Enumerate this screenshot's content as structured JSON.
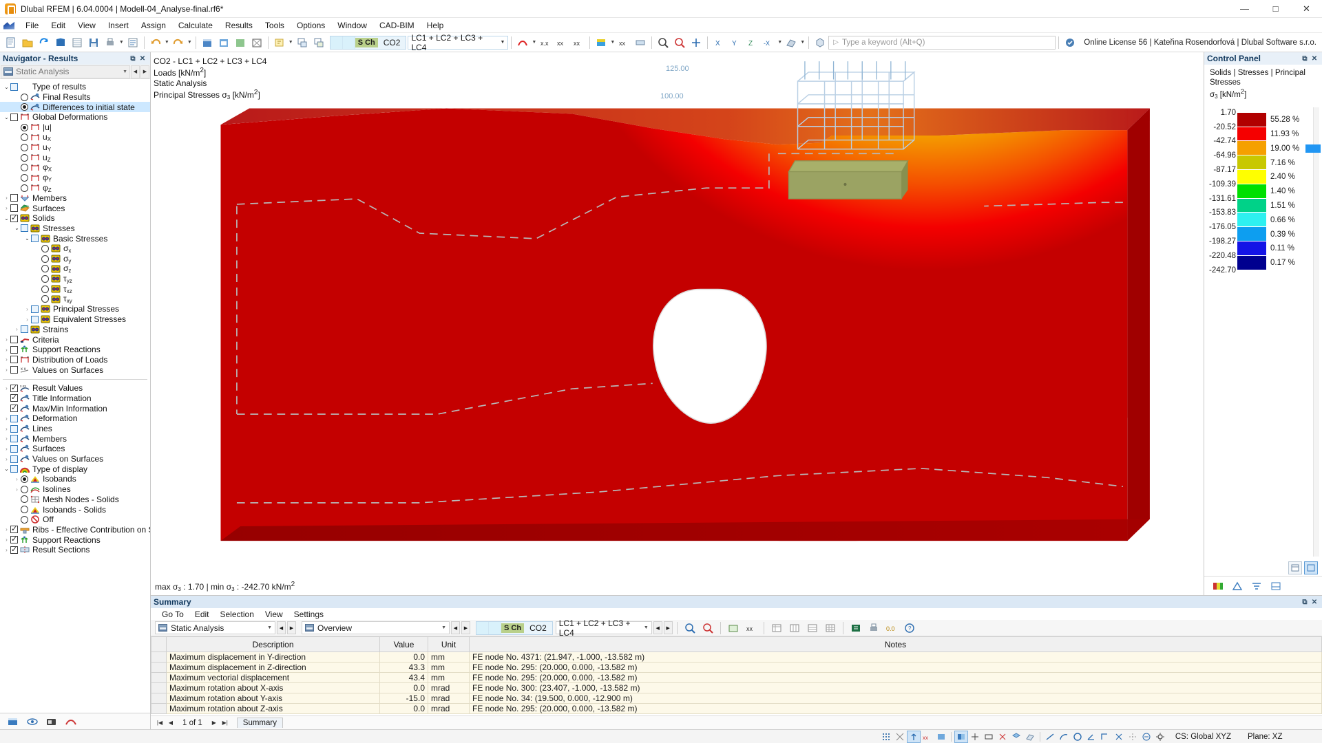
{
  "window": {
    "title": "Dlubal RFEM | 6.04.0004 | Modell-04_Analyse-final.rf6*",
    "minimize": "—",
    "maximize": "□",
    "close": "✕"
  },
  "menubar": {
    "items": [
      "File",
      "Edit",
      "View",
      "Insert",
      "Assign",
      "Calculate",
      "Results",
      "Tools",
      "Options",
      "Window",
      "CAD-BIM",
      "Help"
    ]
  },
  "toolbar": {
    "load_case": {
      "s_ch": "S Ch",
      "combo_code": "CO2",
      "combination": "LC1 + LC2 + LC3 + LC4"
    },
    "search_placeholder": "Type a keyword (Alt+Q)",
    "license": "Online License 56 | Kateřina Rosendorfová | Dlubal Software s.r.o."
  },
  "navigator": {
    "header": "Navigator - Results",
    "restore_btn": "⧉",
    "close_btn": "✕",
    "analysis_selector": "Static Analysis",
    "prev_btn": "◀",
    "next_btn": "▶",
    "tree": [
      {
        "label": "Type of results",
        "indent": 0,
        "exp": "open",
        "ctl": "cbx",
        "state": "blue",
        "icon": "none"
      },
      {
        "label": "Final Results",
        "indent": 1,
        "exp": "none",
        "ctl": "rad",
        "state": "off",
        "icon": "result"
      },
      {
        "label": "Differences to initial state",
        "indent": 1,
        "exp": "none",
        "ctl": "rad",
        "state": "on",
        "icon": "result",
        "selected": true
      },
      {
        "label": "Global Deformations",
        "indent": 0,
        "exp": "open",
        "ctl": "cbx",
        "state": "off",
        "icon": "member"
      },
      {
        "label": "|u|",
        "indent": 1,
        "exp": "none",
        "ctl": "rad",
        "state": "on",
        "icon": "member"
      },
      {
        "label": "u",
        "sub": "X",
        "indent": 1,
        "exp": "none",
        "ctl": "rad",
        "state": "off",
        "icon": "member"
      },
      {
        "label": "u",
        "sub": "Y",
        "indent": 1,
        "exp": "none",
        "ctl": "rad",
        "state": "off",
        "icon": "member"
      },
      {
        "label": "u",
        "sub": "Z",
        "indent": 1,
        "exp": "none",
        "ctl": "rad",
        "state": "off",
        "icon": "member"
      },
      {
        "label": "φ",
        "sub": "X",
        "indent": 1,
        "exp": "none",
        "ctl": "rad",
        "state": "off",
        "icon": "member"
      },
      {
        "label": "φ",
        "sub": "Y",
        "indent": 1,
        "exp": "none",
        "ctl": "rad",
        "state": "off",
        "icon": "member"
      },
      {
        "label": "φ",
        "sub": "Z",
        "indent": 1,
        "exp": "none",
        "ctl": "rad",
        "state": "off",
        "icon": "member"
      },
      {
        "label": "Members",
        "indent": 0,
        "exp": "closed",
        "ctl": "cbx",
        "state": "off",
        "icon": "member2"
      },
      {
        "label": "Surfaces",
        "indent": 0,
        "exp": "closed",
        "ctl": "cbx",
        "state": "off",
        "icon": "surface"
      },
      {
        "label": "Solids",
        "indent": 0,
        "exp": "open",
        "ctl": "cbx",
        "state": "checked",
        "icon": "solid"
      },
      {
        "label": "Stresses",
        "indent": 1,
        "exp": "open",
        "ctl": "cbx",
        "state": "blue",
        "icon": "solid"
      },
      {
        "label": "Basic Stresses",
        "indent": 2,
        "exp": "open",
        "ctl": "cbx",
        "state": "blue",
        "icon": "solid"
      },
      {
        "label": "σ",
        "sub": "x",
        "indent": 3,
        "exp": "none",
        "ctl": "rad",
        "state": "off",
        "icon": "solid"
      },
      {
        "label": "σ",
        "sub": "y",
        "indent": 3,
        "exp": "none",
        "ctl": "rad",
        "state": "off",
        "icon": "solid"
      },
      {
        "label": "σ",
        "sub": "z",
        "indent": 3,
        "exp": "none",
        "ctl": "rad",
        "state": "off",
        "icon": "solid"
      },
      {
        "label": "τ",
        "sub": "yz",
        "indent": 3,
        "exp": "none",
        "ctl": "rad",
        "state": "off",
        "icon": "solid"
      },
      {
        "label": "τ",
        "sub": "xz",
        "indent": 3,
        "exp": "none",
        "ctl": "rad",
        "state": "off",
        "icon": "solid"
      },
      {
        "label": "τ",
        "sub": "xy",
        "indent": 3,
        "exp": "none",
        "ctl": "rad",
        "state": "off",
        "icon": "solid"
      },
      {
        "label": "Principal Stresses",
        "indent": 2,
        "exp": "closed",
        "ctl": "cbx",
        "state": "blue",
        "icon": "solid"
      },
      {
        "label": "Equivalent Stresses",
        "indent": 2,
        "exp": "closed",
        "ctl": "cbx",
        "state": "blue",
        "icon": "solid"
      },
      {
        "label": "Strains",
        "indent": 1,
        "exp": "closed",
        "ctl": "cbx",
        "state": "blue",
        "icon": "solid"
      },
      {
        "label": "Criteria",
        "indent": 0,
        "exp": "closed",
        "ctl": "cbx",
        "state": "off",
        "icon": "criteria"
      },
      {
        "label": "Support Reactions",
        "indent": 0,
        "exp": "closed",
        "ctl": "cbx",
        "state": "off",
        "icon": "support"
      },
      {
        "label": "Distribution of Loads",
        "indent": 0,
        "exp": "closed",
        "ctl": "cbx",
        "state": "off",
        "icon": "member"
      },
      {
        "label": "Values on Surfaces",
        "indent": 0,
        "exp": "closed",
        "ctl": "cbx",
        "state": "off",
        "icon": "values"
      },
      {
        "separator": true
      },
      {
        "label": "Result Values",
        "indent": 0,
        "exp": "closed",
        "ctl": "cbx",
        "state": "checked",
        "icon": "resultvalues"
      },
      {
        "label": "Title Information",
        "indent": 0,
        "exp": "none",
        "ctl": "cbx",
        "state": "checked",
        "icon": "result"
      },
      {
        "label": "Max/Min Information",
        "indent": 0,
        "exp": "none",
        "ctl": "cbx",
        "state": "checked",
        "icon": "result"
      },
      {
        "label": "Deformation",
        "indent": 0,
        "exp": "closed",
        "ctl": "cbx",
        "state": "blue",
        "icon": "result"
      },
      {
        "label": "Lines",
        "indent": 0,
        "exp": "closed",
        "ctl": "cbx",
        "state": "blue",
        "icon": "result"
      },
      {
        "label": "Members",
        "indent": 0,
        "exp": "closed",
        "ctl": "cbx",
        "state": "blue",
        "icon": "result"
      },
      {
        "label": "Surfaces",
        "indent": 0,
        "exp": "closed",
        "ctl": "cbx",
        "state": "blue",
        "icon": "result"
      },
      {
        "label": "Values on Surfaces",
        "indent": 0,
        "exp": "closed",
        "ctl": "cbx",
        "state": "blue",
        "icon": "result"
      },
      {
        "label": "Type of display",
        "indent": 0,
        "exp": "open",
        "ctl": "cbx",
        "state": "blue",
        "icon": "rainbow"
      },
      {
        "label": "Isobands",
        "indent": 1,
        "exp": "closed",
        "ctl": "rad",
        "state": "on",
        "icon": "isoband"
      },
      {
        "label": "Isolines",
        "indent": 1,
        "exp": "closed",
        "ctl": "rad",
        "state": "off",
        "icon": "isoline"
      },
      {
        "label": "Mesh Nodes - Solids",
        "indent": 1,
        "exp": "none",
        "ctl": "rad",
        "state": "off",
        "icon": "mesh"
      },
      {
        "label": "Isobands - Solids",
        "indent": 1,
        "exp": "none",
        "ctl": "rad",
        "state": "off",
        "icon": "isoband"
      },
      {
        "label": "Off",
        "indent": 1,
        "exp": "none",
        "ctl": "rad",
        "state": "off",
        "icon": "off"
      },
      {
        "label": "Ribs - Effective Contribution on Surfa...",
        "indent": 0,
        "exp": "closed",
        "ctl": "cbx",
        "state": "checked",
        "icon": "rib"
      },
      {
        "label": "Support Reactions",
        "indent": 0,
        "exp": "closed",
        "ctl": "cbx",
        "state": "checked",
        "icon": "support"
      },
      {
        "label": "Result Sections",
        "indent": 0,
        "exp": "closed",
        "ctl": "cbx",
        "state": "checked",
        "icon": "section"
      }
    ]
  },
  "viewport": {
    "title_lines": [
      "CO2 - LC1 + LC2 + LC3 + LC4",
      "Loads [kN/m2]",
      "Static Analysis",
      "Principal Stresses σ3 [kN/m2]"
    ],
    "load_labels": [
      "125.00",
      "100.00"
    ],
    "minmax": "max σ3 : 1.70 | min σ3 : -242.70 kN/m2"
  },
  "control_panel": {
    "header": "Control Panel",
    "restore_btn": "⧉",
    "close_btn": "✕",
    "title_line1": "Solids | Stresses | Principal Stresses",
    "title_line2": "σ3 [kN/m2]",
    "scale_values": [
      "1.70",
      "-20.52",
      "-42.74",
      "-64.96",
      "-87.17",
      "-109.39",
      "-131.61",
      "-153.83",
      "-176.05",
      "-198.27",
      "-220.48",
      "-242.70"
    ],
    "bands": [
      {
        "color": "#b10000",
        "percent": "55.28 %"
      },
      {
        "color": "#f50000",
        "percent": "11.93 %"
      },
      {
        "color": "#f5a000",
        "percent": "19.00 %"
      },
      {
        "color": "#c8c800",
        "percent": "7.16 %"
      },
      {
        "color": "#ffff00",
        "percent": "2.40 %"
      },
      {
        "color": "#00e000",
        "percent": "1.40 %"
      },
      {
        "color": "#00d288",
        "percent": "1.51 %"
      },
      {
        "color": "#2ef0f0",
        "percent": "0.66 %"
      },
      {
        "color": "#0d9ef0",
        "percent": "0.39 %"
      },
      {
        "color": "#1414e6",
        "percent": "0.11 %"
      },
      {
        "color": "#00008f",
        "percent": "0.17 %"
      }
    ]
  },
  "summary": {
    "header": "Summary",
    "restore_btn": "⧉",
    "close_btn": "✕",
    "menu": [
      "Go To",
      "Edit",
      "Selection",
      "View",
      "Settings"
    ],
    "analysis_selector": "Static Analysis",
    "view_selector": "Overview",
    "s_ch": "S Ch",
    "combo_code": "CO2",
    "combination": "LC1 + LC2 + LC3 + LC4",
    "columns": [
      "Description",
      "Value",
      "Unit",
      "Notes"
    ],
    "rows": [
      {
        "description": "Maximum displacement in Y-direction",
        "value": "0.0",
        "unit": "mm",
        "notes": "FE node No. 4371: (21.947, -1.000, -13.582 m)"
      },
      {
        "description": "Maximum displacement in Z-direction",
        "value": "43.3",
        "unit": "mm",
        "notes": "FE node No. 295: (20.000, 0.000, -13.582 m)"
      },
      {
        "description": "Maximum vectorial displacement",
        "value": "43.4",
        "unit": "mm",
        "notes": "FE node No. 295: (20.000, 0.000, -13.582 m)"
      },
      {
        "description": "Maximum rotation about X-axis",
        "value": "0.0",
        "unit": "mrad",
        "notes": "FE node No. 300: (23.407, -1.000, -13.582 m)"
      },
      {
        "description": "Maximum rotation about Y-axis",
        "value": "-15.0",
        "unit": "mrad",
        "notes": "FE node No. 34: (19.500, 0.000, -12.900 m)"
      },
      {
        "description": "Maximum rotation about Z-axis",
        "value": "0.0",
        "unit": "mrad",
        "notes": "FE node No. 295: (20.000, 0.000, -13.582 m)"
      }
    ],
    "page_info": "1 of 1",
    "tab": "Summary",
    "first_btn": "|◀",
    "prev_btn": "◀",
    "next_btn": "▶",
    "last_btn": "▶|"
  },
  "statusbar": {
    "cs": "CS: Global XYZ",
    "plane": "Plane: XZ"
  }
}
